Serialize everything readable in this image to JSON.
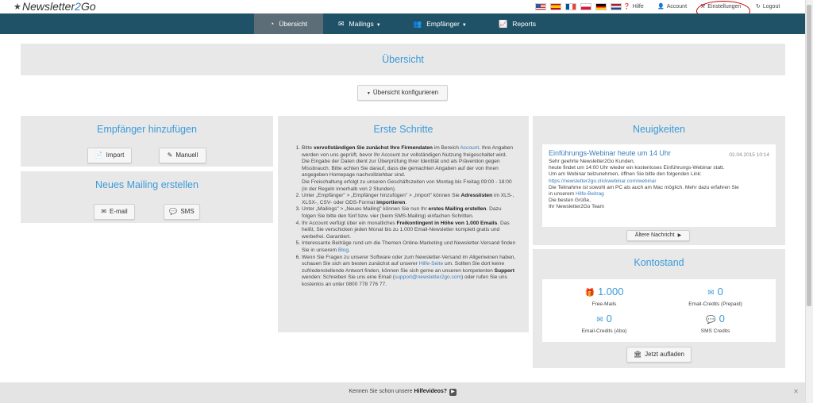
{
  "header": {
    "logo_prefix": "Newsletter",
    "logo_number": "2",
    "logo_suffix": "Go",
    "languages": [
      "English",
      "Español",
      "Français",
      "Polski",
      "Deutsch",
      "Nederlands"
    ],
    "help": "Hilfe",
    "account": "Account",
    "settings": "Einstellungen",
    "logout": "Logout"
  },
  "nav": {
    "items": [
      {
        "label": "Übersicht",
        "icon": "speedometer-icon"
      },
      {
        "label": "Mailings",
        "icon": "envelope-icon"
      },
      {
        "label": "Empfänger",
        "icon": "users-icon"
      },
      {
        "label": "Reports",
        "icon": "chart-icon"
      }
    ]
  },
  "overview": {
    "title": "Übersicht",
    "configure_button": "Übersicht konfigurieren"
  },
  "recipients": {
    "title": "Empfänger hinzufügen",
    "import": "Import",
    "manual": "Manuell"
  },
  "mailing": {
    "title": "Neues Mailing erstellen",
    "email": "E-mail",
    "sms": "SMS"
  },
  "first_steps": {
    "title": "Erste Schritte"
  },
  "news": {
    "title": "Neuigkeiten",
    "item_title": "Einführungs-Webinar heute um 14 Uhr",
    "item_date": "02.04.2015 10:14",
    "line1": "Sehr geehrte Newsletter2Go Kunden,",
    "line2": "heute findet um 14:00 Uhr wieder ein kostenloses Einführungs-Webinar statt.",
    "line3": "Um am Webinar teilzunehmen, öffnen Sie bitte den folgenden Link:",
    "link": "https://newsletter2go.clickwebinar.com/webinar",
    "line4": "Die Teilnahme ist sowohl am PC als auch am Mac möglich. Mehr dazu erfahren Sie",
    "line5_prefix": "in unserem",
    "line5_link": "Hilfe-Beitrag",
    "line6": "Die besten Grüße,",
    "line7": "Ihr Newsletter2Go Team",
    "older_button": "Ältere Nachricht"
  },
  "account_status": {
    "title": "Kontostand",
    "free_mails_value": "1.000",
    "free_mails_label": "Free-Mails",
    "email_prepaid_value": "0",
    "email_prepaid_label": "Email-Credits (Prepaid)",
    "email_abo_value": "0",
    "email_abo_label": "Email-Credits (Abo)",
    "sms_value": "0",
    "sms_label": "SMS Credits",
    "topup_button": "Jetzt aufladen"
  },
  "footer": {
    "prefix": "Kennen Sie schon unsere",
    "bold": "Hilfevideos?"
  }
}
